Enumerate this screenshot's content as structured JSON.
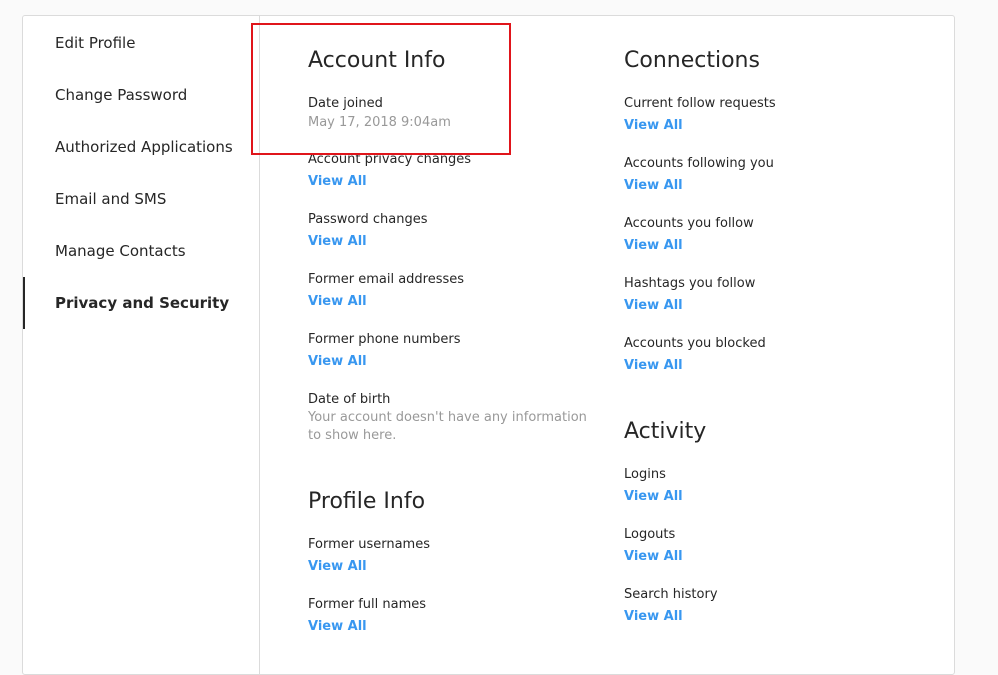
{
  "sidebar": {
    "items": [
      {
        "label": "Edit Profile"
      },
      {
        "label": "Change Password"
      },
      {
        "label": "Authorized Applications"
      },
      {
        "label": "Email and SMS"
      },
      {
        "label": "Manage Contacts"
      },
      {
        "label": "Privacy and Security"
      }
    ],
    "active_index": 5
  },
  "account_info": {
    "title": "Account Info",
    "date_joined_label": "Date joined",
    "date_joined_value": "May 17, 2018 9:04am",
    "privacy_changes_label": "Account privacy changes",
    "privacy_changes_link": "View All",
    "password_changes_label": "Password changes",
    "password_changes_link": "View All",
    "former_emails_label": "Former email addresses",
    "former_emails_link": "View All",
    "former_phones_label": "Former phone numbers",
    "former_phones_link": "View All",
    "dob_label": "Date of birth",
    "dob_value": "Your account doesn't have any information to show here."
  },
  "profile_info": {
    "title": "Profile Info",
    "former_usernames_label": "Former usernames",
    "former_usernames_link": "View All",
    "former_full_names_label": "Former full names",
    "former_full_names_link": "View All"
  },
  "connections": {
    "title": "Connections",
    "follow_requests_label": "Current follow requests",
    "follow_requests_link": "View All",
    "following_you_label": "Accounts following you",
    "following_you_link": "View All",
    "you_follow_label": "Accounts you follow",
    "you_follow_link": "View All",
    "hashtags_label": "Hashtags you follow",
    "hashtags_link": "View All",
    "blocked_label": "Accounts you blocked",
    "blocked_link": "View All"
  },
  "activity": {
    "title": "Activity",
    "logins_label": "Logins",
    "logins_link": "View All",
    "logouts_label": "Logouts",
    "logouts_link": "View All",
    "search_history_label": "Search history",
    "search_history_link": "View All"
  },
  "colors": {
    "link": "#3897f0",
    "highlight": "#e0151b",
    "muted": "#999999",
    "text": "#262626"
  }
}
